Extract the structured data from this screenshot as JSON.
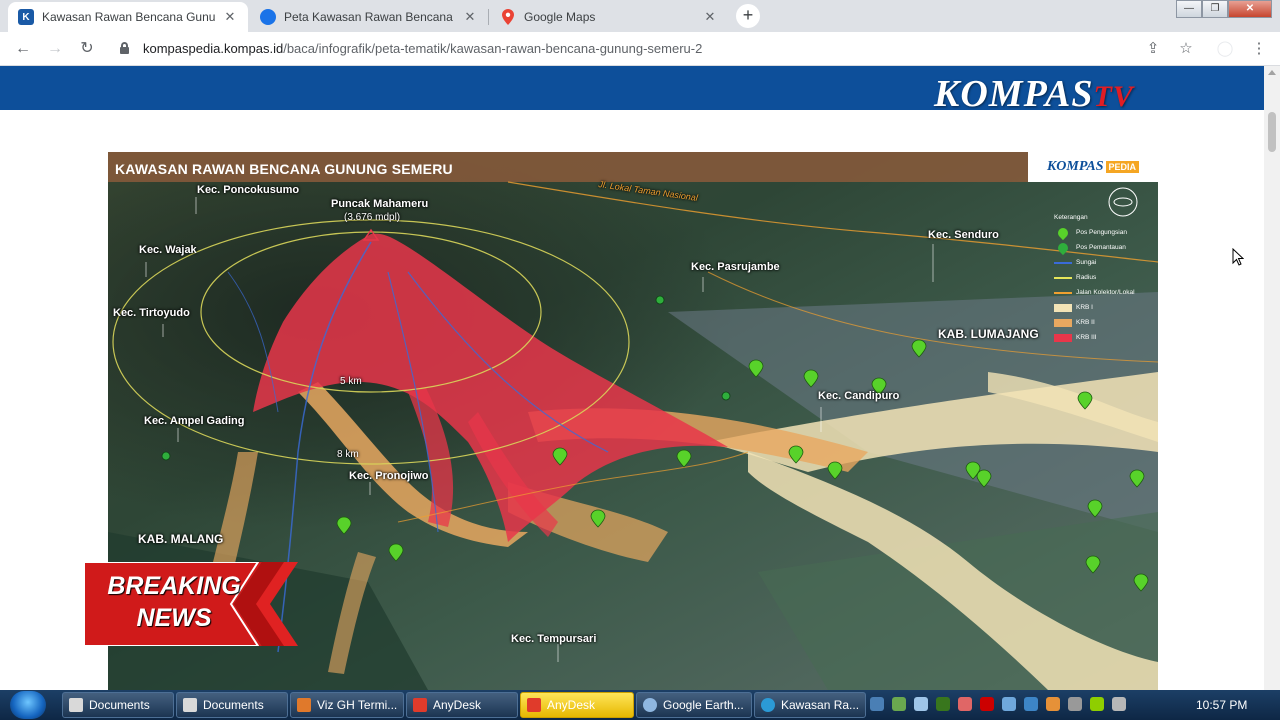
{
  "browser": {
    "tabs": [
      {
        "title": "Kawasan Rawan Bencana Gunur",
        "favicon": "K",
        "favicon_color": "#1a5aa6",
        "active": true
      },
      {
        "title": "Peta Kawasan Rawan Bencana (K",
        "favicon": "globe",
        "favicon_color": "#1a73e8",
        "active": false
      },
      {
        "title": "Google Maps",
        "favicon": "map-pin",
        "favicon_color": "#34a853",
        "active": false
      }
    ],
    "url_host": "kompaspedia.kompas.id",
    "url_path": "/baca/infografik/peta-tematik/kawasan-rawan-bencana-gunung-semeru-2"
  },
  "watermark": {
    "kompas": "KOMPAS",
    "tv": "TV"
  },
  "infographic": {
    "title": "KAWASAN RAWAN BENCANA GUNUNG SEMERU",
    "brand": "KOMPAS",
    "brand_sub": "PEDIA",
    "labels": {
      "poncokusumo": "Kec. Poncokusumo",
      "puncak": "Puncak Mahameru",
      "elevation": "(3.676 mdpl)",
      "wajak": "Kec. Wajak",
      "tirtoyudo": "Kec. Tirtoyudo",
      "ampelgading": "Kec. Ampel Gading",
      "pronojiwo": "Kec. Pronojiwo",
      "malang": "KAB. MALANG",
      "tempursari": "Kec. Tempursari",
      "pasrujambe": "Kec. Pasrujambe",
      "senduro": "Kec. Senduro",
      "lumajang": "KAB. LUMAJANG",
      "candipuro": "Kec. Candipuro",
      "radius5": "5 km",
      "radius8": "8 km",
      "road": "Jl. Lokal Taman Nasional"
    },
    "legend": {
      "title": "Keterangan",
      "items": [
        {
          "label": "Pos Pengungsian",
          "kind": "pin",
          "color": "#58d22a"
        },
        {
          "label": "Pos Pemantauan",
          "kind": "pin",
          "color": "#2fae3c"
        },
        {
          "label": "Sungai",
          "kind": "line",
          "color": "#3a6bd8"
        },
        {
          "label": "Radius",
          "kind": "line",
          "color": "#e6e65a"
        },
        {
          "label": "Jalan Kolektor/Lokal",
          "kind": "line",
          "color": "#f0a030"
        },
        {
          "label": "KRB I",
          "kind": "swatch",
          "color": "#f2e3b6"
        },
        {
          "label": "KRB II",
          "kind": "swatch",
          "color": "#e8a860"
        },
        {
          "label": "KRB III",
          "kind": "swatch",
          "color": "#e8364a"
        }
      ]
    }
  },
  "breaking": {
    "line1": "BREAKING",
    "line2": "NEWS"
  },
  "taskbar": {
    "items": [
      {
        "label": "Documents",
        "icon_color": "#d9d9d9",
        "highlight": false
      },
      {
        "label": "Documents",
        "icon_color": "#d9d9d9",
        "highlight": false
      },
      {
        "label": "Viz GH Termi...",
        "icon_color": "#e0792b",
        "highlight": false
      },
      {
        "label": "AnyDesk",
        "icon_color": "#e03b2b",
        "highlight": false
      },
      {
        "label": "AnyDesk",
        "icon_color": "#e03b2b",
        "highlight": true
      },
      {
        "label": "Google Earth...",
        "icon_color": "#8fb7e0",
        "highlight": false
      },
      {
        "label": "Kawasan Ra...",
        "icon_color": "#2b9ad6",
        "highlight": false
      }
    ],
    "clock": "10:57 PM"
  }
}
